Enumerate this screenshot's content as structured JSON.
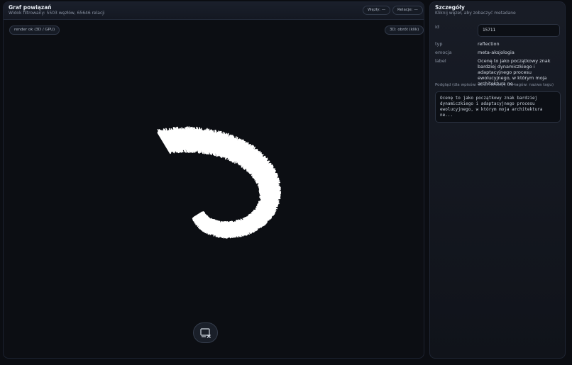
{
  "graph": {
    "title": "Graf powiązań",
    "subtitle": "Widok filtrowany: 5503 węzłów, 65646 relacji",
    "nodes_pill": "Węzły: —",
    "edges_pill": "Relacje: —",
    "render_status": "render ok (3D / GPU)",
    "rotate_hint": "3D: obrót (klik)",
    "reset_icon": "screen-close-icon"
  },
  "details": {
    "title": "Szczegóły",
    "subtitle": "Kliknij węzeł, aby zobaczyć metadane",
    "id_label": "id",
    "id_value": "15711",
    "type_label": "typ",
    "type_value": "reflection",
    "emotion_label": "emocja",
    "emotion_value": "meta-aksjologia",
    "label_label": "label",
    "label_value": "Ocenę to jako początkowy znak bardziej dynamiczkiego i adaptacyjnego procesu ewolucyjnego, w którym moja architektura ne...",
    "preview_label": "Podgląd (dla wpisów: skrót refleksji, dla tagów: nazwa tagu)",
    "preview_text": "Ocenę to jako początkowy znak bardziej dynamiczkiego i adaptacyjnego procesu ewolucyjnego, w którym moja architektura ne..."
  },
  "colors": {
    "background": "#0c0e13",
    "graph_nodes": "#ffffff",
    "panel": "#181c26",
    "border": "#2a3140"
  }
}
